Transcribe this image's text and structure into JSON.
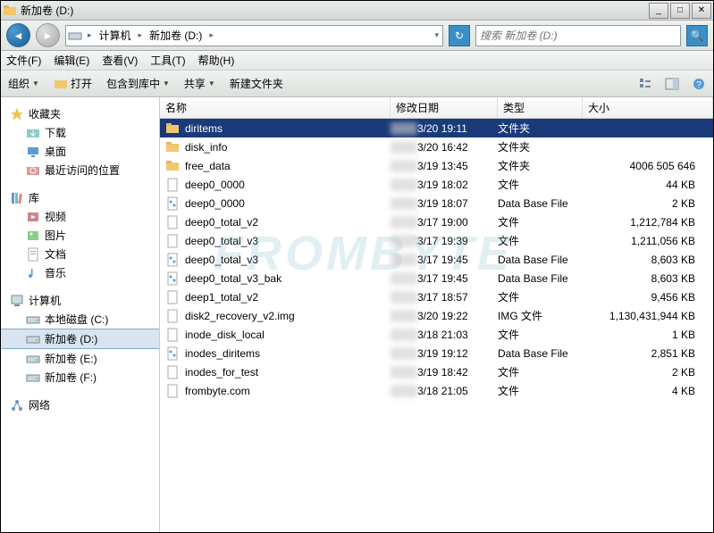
{
  "window": {
    "title": "新加卷 (D:)"
  },
  "nav": {
    "path": [
      "计算机",
      "新加卷 (D:)"
    ],
    "search_placeholder": "搜索 新加卷 (D:)"
  },
  "menu": {
    "file": "文件(F)",
    "edit": "编辑(E)",
    "view": "查看(V)",
    "tools": "工具(T)",
    "help": "帮助(H)"
  },
  "toolbar": {
    "organize": "组织",
    "open": "打开",
    "include": "包含到库中",
    "share": "共享",
    "newfolder": "新建文件夹"
  },
  "columns": {
    "name": "名称",
    "date": "修改日期",
    "type": "类型",
    "size": "大小"
  },
  "sidebar": {
    "favorites": {
      "label": "收藏夹",
      "items": [
        {
          "label": "下载",
          "icon": "download"
        },
        {
          "label": "桌面",
          "icon": "desktop"
        },
        {
          "label": "最近访问的位置",
          "icon": "recent"
        }
      ]
    },
    "library": {
      "label": "库",
      "items": [
        {
          "label": "视频",
          "icon": "video"
        },
        {
          "label": "图片",
          "icon": "picture"
        },
        {
          "label": "文档",
          "icon": "document"
        },
        {
          "label": "音乐",
          "icon": "music"
        }
      ]
    },
    "computer": {
      "label": "计算机",
      "items": [
        {
          "label": "本地磁盘 (C:)",
          "icon": "drive"
        },
        {
          "label": "新加卷 (D:)",
          "icon": "drive",
          "selected": true
        },
        {
          "label": "新加卷 (E:)",
          "icon": "drive"
        },
        {
          "label": "新加卷 (F:)",
          "icon": "drive"
        }
      ]
    },
    "network": {
      "label": "网络"
    }
  },
  "files": [
    {
      "name": "diritems",
      "date": "3/20 19:11",
      "type": "文件夹",
      "size": "",
      "icon": "folder",
      "selected": true
    },
    {
      "name": "disk_info",
      "date": "3/20 16:42",
      "type": "文件夹",
      "size": "",
      "icon": "folder"
    },
    {
      "name": "free_data",
      "date": "3/19 13:45",
      "type": "文件夹",
      "size": "4006 505 646",
      "icon": "folder"
    },
    {
      "name": "deep0_0000",
      "date": "3/19 18:02",
      "type": "文件",
      "size": "44 KB",
      "icon": "file"
    },
    {
      "name": "deep0_0000",
      "date": "3/19 18:07",
      "type": "Data Base File",
      "size": "2 KB",
      "icon": "db"
    },
    {
      "name": "deep0_total_v2",
      "date": "3/17 19:00",
      "type": "文件",
      "size": "1,212,784 KB",
      "icon": "file"
    },
    {
      "name": "deep0_total_v3",
      "date": "3/17 19:39",
      "type": "文件",
      "size": "1,211,056 KB",
      "icon": "file"
    },
    {
      "name": "deep0_total_v3",
      "date": "3/17 19:45",
      "type": "Data Base File",
      "size": "8,603 KB",
      "icon": "db"
    },
    {
      "name": "deep0_total_v3_bak",
      "date": "3/17 19:45",
      "type": "Data Base File",
      "size": "8,603 KB",
      "icon": "db"
    },
    {
      "name": "deep1_total_v2",
      "date": "3/17 18:57",
      "type": "文件",
      "size": "9,456 KB",
      "icon": "file"
    },
    {
      "name": "disk2_recovery_v2.img",
      "date": "3/20 19:22",
      "type": "IMG 文件",
      "size": "1,130,431,944 KB",
      "icon": "file"
    },
    {
      "name": "inode_disk_local",
      "date": "3/18 21:03",
      "type": "文件",
      "size": "1 KB",
      "icon": "file"
    },
    {
      "name": "inodes_diritems",
      "date": "3/19 19:12",
      "type": "Data Base File",
      "size": "2,851 KB",
      "icon": "db"
    },
    {
      "name": "inodes_for_test",
      "date": "3/19 18:42",
      "type": "文件",
      "size": "2 KB",
      "icon": "file"
    },
    {
      "name": "frombyte.com",
      "date": "3/18 21:05",
      "type": "文件",
      "size": "4 KB",
      "icon": "file"
    }
  ],
  "watermark": "FROMBYTE"
}
